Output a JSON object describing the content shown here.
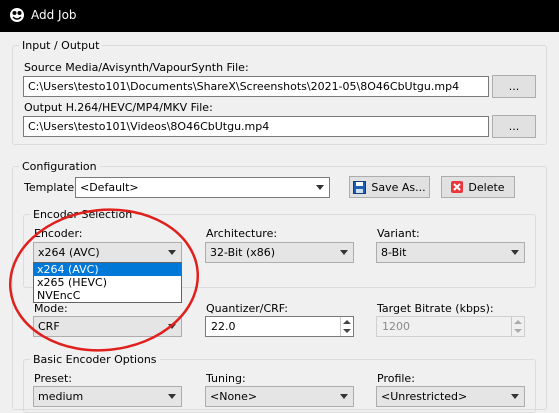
{
  "window": {
    "title": "Add Job"
  },
  "input_output": {
    "legend": "Input / Output",
    "source_label": "Source Media/Avisynth/VapourSynth File:",
    "source_value": "C:\\Users\\testo101\\Documents\\ShareX\\Screenshots\\2021-05\\8O46CbUtgu.mp4",
    "source_browse": "...",
    "output_label": "Output H.264/HEVC/MP4/MKV File:",
    "output_value": "C:\\Users\\testo101\\Videos\\8O46CbUtgu.mp4",
    "output_browse": "..."
  },
  "configuration": {
    "legend": "Configuration",
    "template_label": "Template:",
    "template_value": "<Default>",
    "save_as": "Save As...",
    "delete": "Delete",
    "encoder_selection": {
      "legend": "Encoder Selection",
      "encoder_label": "Encoder:",
      "encoder_value": "x264 (AVC)",
      "encoder_options": [
        "x264 (AVC)",
        "x265 (HEVC)",
        "NVEncC"
      ],
      "architecture_label": "Architecture:",
      "architecture_value": "32-Bit (x86)",
      "variant_label": "Variant:",
      "variant_value": "8-Bit"
    },
    "mode_label": "Mode:",
    "mode_value": "CRF",
    "quantizer_label": "Quantizer/CRF:",
    "quantizer_value": "22.0",
    "bitrate_label": "Target Bitrate (kbps):",
    "bitrate_value": "1200",
    "basic": {
      "legend": "Basic Encoder Options",
      "preset_label": "Preset:",
      "preset_value": "medium",
      "tuning_label": "Tuning:",
      "tuning_value": "<None>",
      "profile_label": "Profile:",
      "profile_value": "<Unrestricted>"
    }
  },
  "colors": {
    "highlight_circle": "#e0201c",
    "selection": "#0078d7",
    "delete_icon": "#e8383d",
    "save_icon": "#1e5fb4"
  }
}
